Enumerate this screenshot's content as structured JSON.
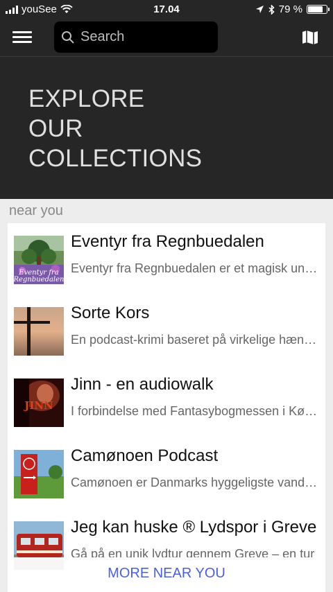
{
  "status_bar": {
    "carrier": "youSee",
    "time": "17.04",
    "battery_text": "79 %",
    "battery_level": 0.79
  },
  "search": {
    "placeholder": "Search"
  },
  "hero": {
    "line1": "EXPLORE",
    "line2": "OUR",
    "line3": "COLLECTIONS"
  },
  "near_you": {
    "header": "near you",
    "items": [
      {
        "title": "Eventyr fra Regnbuedalen",
        "description": "Eventyr fra Regnbuedalen er et magisk univers",
        "thumb_icon": "fairytale-forest-thumbnail"
      },
      {
        "title": "Sorte Kors",
        "description": "En podcast-krimi baseret på virkelige hændelser",
        "thumb_icon": "black-cross-thumbnail"
      },
      {
        "title": "Jinn - en audiowalk",
        "description": "I forbindelse med Fantasybogmessen i København",
        "thumb_icon": "jinn-thumbnail"
      },
      {
        "title": "Camønoen Podcast",
        "description": "Camønoen er Danmarks hyggeligste vandrerute",
        "thumb_icon": "camino-sign-thumbnail"
      },
      {
        "title": "Jeg kan huske ® Lydspor i Greve",
        "description": "Gå på en unik lydtur gennem Greve – en tur",
        "thumb_icon": "train-thumbnail"
      }
    ],
    "more_label": "MORE NEAR YOU"
  },
  "colors": {
    "dark_bg": "#262626",
    "accent": "#4a5fe0",
    "list_bg": "#ededed"
  }
}
